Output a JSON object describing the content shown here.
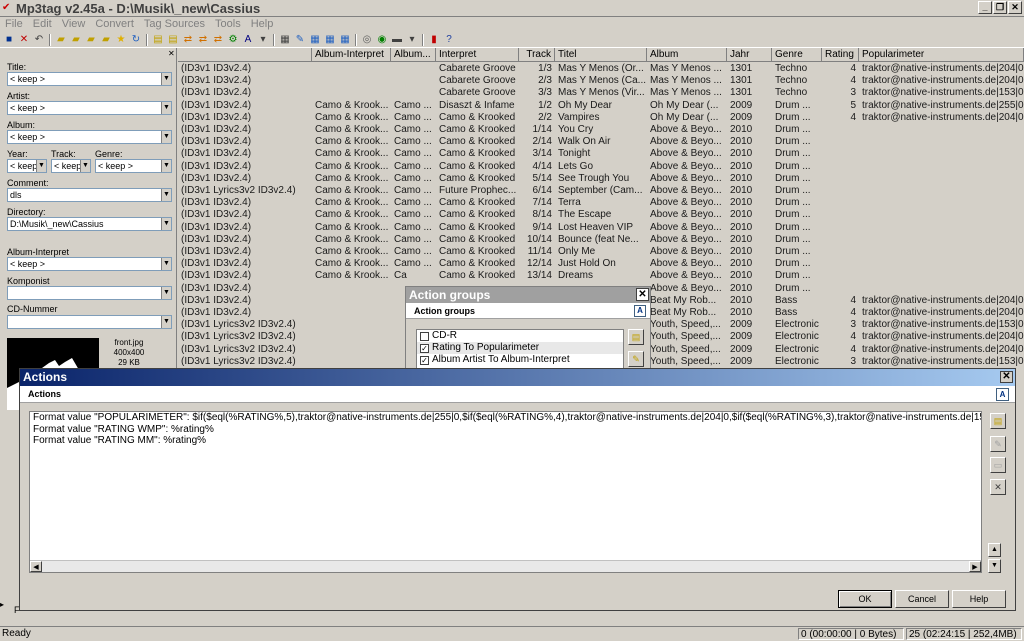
{
  "window": {
    "title": "Mp3tag v2.45a  -  D:\\Musik\\_new\\Cassius",
    "btn_min": "_",
    "btn_restore": "❐",
    "btn_close": "✕"
  },
  "menu": [
    "File",
    "Edit",
    "View",
    "Convert",
    "Tag Sources",
    "Tools",
    "Help"
  ],
  "left_panel": {
    "title_label": "Title:",
    "title_value": "< keep >",
    "artist_label": "Artist:",
    "artist_value": "< keep >",
    "album_label": "Album:",
    "album_value": "< keep >",
    "year_label": "Year:",
    "year_value": "< keep",
    "track_label": "Track:",
    "track_value": "< keep",
    "genre_label": "Genre:",
    "genre_value": "< keep >",
    "comment_label": "Comment:",
    "comment_value": "dls",
    "directory_label": "Directory:",
    "directory_value": "D:\\Musik\\_new\\Cassius",
    "album_interpret_label": "Album-Interpret",
    "album_interpret_value": "< keep >",
    "komponist_label": "Komponist",
    "komponist_value": "",
    "cdnummer_label": "CD-Nummer",
    "cdnummer_value": "",
    "cover_name": "front.jpg",
    "cover_dims": "400x400",
    "cover_size": "29 KB"
  },
  "columns": [
    "",
    "Album-Interpret",
    "Album...",
    "Interpret",
    "Track",
    "Titel",
    "Album",
    "Jahr",
    "Genre",
    "Rating",
    "Popularimeter"
  ],
  "rows": [
    {
      "tag": "(ID3v1 ID3v2.4)",
      "ai": "",
      "al": "",
      "interpret": "Cabarete Groove",
      "track": "1/3",
      "titel": "Mas Y Menos (Or...",
      "album": "Mas Y Menos ...",
      "jahr": "1301",
      "genre": "Techno",
      "rating": "4",
      "pop": "traktor@native-instruments.de|204|0"
    },
    {
      "tag": "(ID3v1 ID3v2.4)",
      "ai": "",
      "al": "",
      "interpret": "Cabarete Groove",
      "track": "2/3",
      "titel": "Mas Y Menos (Ca...",
      "album": "Mas Y Menos ...",
      "jahr": "1301",
      "genre": "Techno",
      "rating": "4",
      "pop": "traktor@native-instruments.de|204|0"
    },
    {
      "tag": "(ID3v1 ID3v2.4)",
      "ai": "",
      "al": "",
      "interpret": "Cabarete Groove",
      "track": "3/3",
      "titel": "Mas Y Menos (Vir...",
      "album": "Mas Y Menos ...",
      "jahr": "1301",
      "genre": "Techno",
      "rating": "3",
      "pop": "traktor@native-instruments.de|153|0"
    },
    {
      "tag": "(ID3v1 ID3v2.4)",
      "ai": "Camo & Krook...",
      "al": "Camo ...",
      "interpret": "Disaszt & Infame",
      "track": "1/2",
      "titel": "Oh My Dear",
      "album": "Oh My Dear (...",
      "jahr": "2009",
      "genre": "Drum ...",
      "rating": "5",
      "pop": "traktor@native-instruments.de|255|0"
    },
    {
      "tag": "(ID3v1 ID3v2.4)",
      "ai": "Camo & Krook...",
      "al": "Camo ...",
      "interpret": "Camo & Krooked",
      "track": "2/2",
      "titel": "Vampires",
      "album": "Oh My Dear (...",
      "jahr": "2009",
      "genre": "Drum ...",
      "rating": "4",
      "pop": "traktor@native-instruments.de|204|0"
    },
    {
      "tag": "(ID3v1 ID3v2.4)",
      "ai": "Camo & Krook...",
      "al": "Camo ...",
      "interpret": "Camo & Krooked",
      "track": "1/14",
      "titel": "You Cry",
      "album": "Above & Beyo...",
      "jahr": "2010",
      "genre": "Drum ...",
      "rating": "",
      "pop": ""
    },
    {
      "tag": "(ID3v1 ID3v2.4)",
      "ai": "Camo & Krook...",
      "al": "Camo ...",
      "interpret": "Camo & Krooked",
      "track": "2/14",
      "titel": "Walk On Air",
      "album": "Above & Beyo...",
      "jahr": "2010",
      "genre": "Drum ...",
      "rating": "",
      "pop": ""
    },
    {
      "tag": "(ID3v1 ID3v2.4)",
      "ai": "Camo & Krook...",
      "al": "Camo ...",
      "interpret": "Camo & Krooked",
      "track": "3/14",
      "titel": "Tonight",
      "album": "Above & Beyo...",
      "jahr": "2010",
      "genre": "Drum ...",
      "rating": "",
      "pop": ""
    },
    {
      "tag": "(ID3v1 ID3v2.4)",
      "ai": "Camo & Krook...",
      "al": "Camo ...",
      "interpret": "Camo & Krooked",
      "track": "4/14",
      "titel": "Lets Go",
      "album": "Above & Beyo...",
      "jahr": "2010",
      "genre": "Drum ...",
      "rating": "",
      "pop": ""
    },
    {
      "tag": "(ID3v1 ID3v2.4)",
      "ai": "Camo & Krook...",
      "al": "Camo ...",
      "interpret": "Camo & Krooked",
      "track": "5/14",
      "titel": "See Trough You",
      "album": "Above & Beyo...",
      "jahr": "2010",
      "genre": "Drum ...",
      "rating": "",
      "pop": ""
    },
    {
      "tag": "(ID3v1 Lyrics3v2 ID3v2.4)",
      "ai": "Camo & Krook...",
      "al": "Camo ...",
      "interpret": "Future Prophec...",
      "track": "6/14",
      "titel": "September (Cam...",
      "album": "Above & Beyo...",
      "jahr": "2010",
      "genre": "Drum ...",
      "rating": "",
      "pop": ""
    },
    {
      "tag": "(ID3v1 ID3v2.4)",
      "ai": "Camo & Krook...",
      "al": "Camo ...",
      "interpret": "Camo & Krooked",
      "track": "7/14",
      "titel": "Terra",
      "album": "Above & Beyo...",
      "jahr": "2010",
      "genre": "Drum ...",
      "rating": "",
      "pop": ""
    },
    {
      "tag": "(ID3v1 ID3v2.4)",
      "ai": "Camo & Krook...",
      "al": "Camo ...",
      "interpret": "Camo & Krooked",
      "track": "8/14",
      "titel": "The Escape",
      "album": "Above & Beyo...",
      "jahr": "2010",
      "genre": "Drum ...",
      "rating": "",
      "pop": ""
    },
    {
      "tag": "(ID3v1 ID3v2.4)",
      "ai": "Camo & Krook...",
      "al": "Camo ...",
      "interpret": "Camo & Krooked",
      "track": "9/14",
      "titel": "Lost Heaven VIP",
      "album": "Above & Beyo...",
      "jahr": "2010",
      "genre": "Drum ...",
      "rating": "",
      "pop": ""
    },
    {
      "tag": "(ID3v1 ID3v2.4)",
      "ai": "Camo & Krook...",
      "al": "Camo ...",
      "interpret": "Camo & Krooked",
      "track": "10/14",
      "titel": "Bounce (feat Ne...",
      "album": "Above & Beyo...",
      "jahr": "2010",
      "genre": "Drum ...",
      "rating": "",
      "pop": ""
    },
    {
      "tag": "(ID3v1 ID3v2.4)",
      "ai": "Camo & Krook...",
      "al": "Camo ...",
      "interpret": "Camo & Krooked",
      "track": "11/14",
      "titel": "Only Me",
      "album": "Above & Beyo...",
      "jahr": "2010",
      "genre": "Drum ...",
      "rating": "",
      "pop": ""
    },
    {
      "tag": "(ID3v1 ID3v2.4)",
      "ai": "Camo & Krook...",
      "al": "Camo ...",
      "interpret": "Camo & Krooked",
      "track": "12/14",
      "titel": "Just Hold On",
      "album": "Above & Beyo...",
      "jahr": "2010",
      "genre": "Drum ...",
      "rating": "",
      "pop": ""
    },
    {
      "tag": "(ID3v1 ID3v2.4)",
      "ai": "Camo & Krook...",
      "al": "Ca",
      "interpret": "Camo & Krooked",
      "track": "13/14",
      "titel": "Dreams",
      "album": "Above & Beyo...",
      "jahr": "2010",
      "genre": "Drum ...",
      "rating": "",
      "pop": ""
    },
    {
      "tag": "(ID3v1 ID3v2.4)",
      "ai": "",
      "al": "",
      "interpret": "",
      "track": "",
      "titel": "",
      "album": "Above & Beyo...",
      "jahr": "2010",
      "genre": "Drum ...",
      "rating": "",
      "pop": ""
    },
    {
      "tag": "(ID3v1 ID3v2.4)",
      "ai": "",
      "al": "",
      "interpret": "",
      "track": "",
      "titel": "",
      "album": "Beat My Rob...",
      "jahr": "2010",
      "genre": "Bass",
      "rating": "4",
      "pop": "traktor@native-instruments.de|204|0"
    },
    {
      "tag": "(ID3v1 ID3v2.4)",
      "ai": "",
      "al": "",
      "interpret": "",
      "track": "",
      "titel": "",
      "album": "Beat My Rob...",
      "jahr": "2010",
      "genre": "Bass",
      "rating": "4",
      "pop": "traktor@native-instruments.de|204|0"
    },
    {
      "tag": "(ID3v1 Lyrics3v2 ID3v2.4)",
      "ai": "",
      "al": "",
      "interpret": "",
      "track": "",
      "titel": "",
      "album": "Youth, Speed,...",
      "jahr": "2009",
      "genre": "Electronic",
      "rating": "3",
      "pop": "traktor@native-instruments.de|153|0"
    },
    {
      "tag": "(ID3v1 Lyrics3v2 ID3v2.4)",
      "ai": "",
      "al": "",
      "interpret": "",
      "track": "",
      "titel": "",
      "album": "Youth, Speed,...",
      "jahr": "2009",
      "genre": "Electronic",
      "rating": "4",
      "pop": "traktor@native-instruments.de|204|0"
    },
    {
      "tag": "(ID3v1 Lyrics3v2 ID3v2.4)",
      "ai": "",
      "al": "",
      "interpret": "",
      "track": "",
      "titel": "",
      "album": "Youth, Speed,...",
      "jahr": "2009",
      "genre": "Electronic",
      "rating": "4",
      "pop": "traktor@native-instruments.de|204|0"
    },
    {
      "tag": "(ID3v1 Lyrics3v2 ID3v2.4)",
      "ai": "",
      "al": "",
      "interpret": "",
      "track": "",
      "titel": "",
      "album": "Youth, Speed,...",
      "jahr": "2009",
      "genre": "Electronic",
      "rating": "3",
      "pop": "traktor@native-instruments.de|153|0"
    }
  ],
  "action_groups": {
    "title": "Action groups",
    "header": "Action groups",
    "close": "✕",
    "items": [
      {
        "label": "CD-R",
        "checked": ""
      },
      {
        "label": "Rating To Popularimeter",
        "checked": "✓"
      },
      {
        "label": "Album Artist To Album-Interpret",
        "checked": "✓"
      }
    ]
  },
  "actions": {
    "title": "Actions",
    "header": "Actions",
    "close": "✕",
    "items": [
      "Format value \"POPULARIMETER\": $if($eql(%RATING%,5),traktor@native-instruments.de|255|0,$if($eql(%RATING%,4),traktor@native-instruments.de|204|0,$if($eql(%RATING%,3),traktor@native-instruments.de|153",
      "Format value \"RATING WMP\": %rating%",
      "Format value \"RATING MM\": %rating%"
    ],
    "ok": "OK",
    "cancel": "Cancel",
    "help": "Help"
  },
  "status": {
    "left": "Ready",
    "mid": "0 (00:00:00 | 0 Bytes)",
    "right": "25 (02:24:15 | 252,4MB)"
  },
  "bottom_fragment": "F"
}
